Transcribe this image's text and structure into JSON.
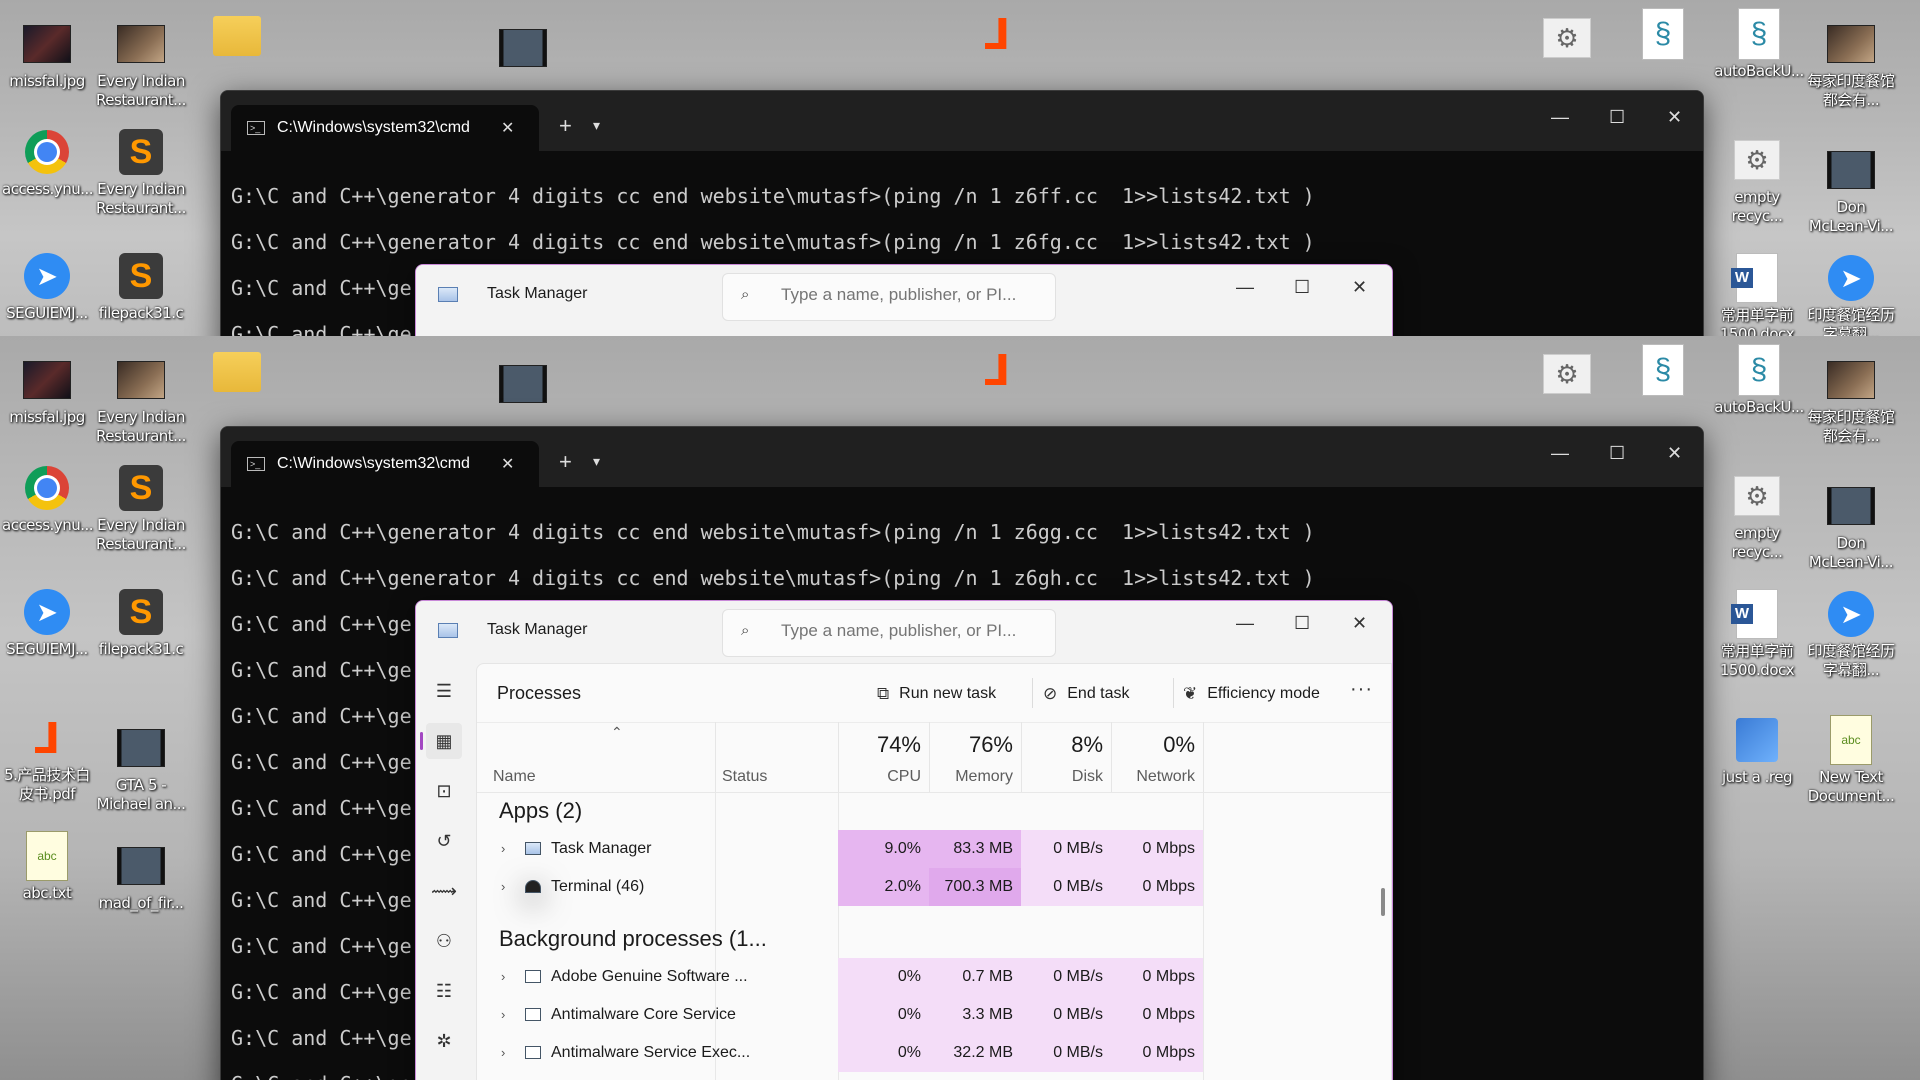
{
  "desktop": {
    "icons_left": [
      {
        "label": "missfal.jpg",
        "icon": "photo-thumb-icon"
      },
      {
        "label": "Every Indian Restaurant...",
        "icon": "video-thumb-icon"
      },
      {
        "label": "access.ynu...",
        "icon": "chrome-icon"
      },
      {
        "label": "Every Indian Restaurant...",
        "icon": "sublime-icon"
      },
      {
        "label": "SEGUIEMJ...",
        "icon": "blue-app-icon"
      },
      {
        "label": "filepack31.c",
        "icon": "sublime-icon"
      },
      {
        "label": "5.产品技术白皮书.pdf",
        "icon": "foxit-icon"
      },
      {
        "label": "GTA 5 - Michael an...",
        "icon": "video-thumb-icon"
      },
      {
        "label": "abc.txt",
        "icon": "notepad-icon"
      },
      {
        "label": "mad_of_fir...",
        "icon": "video-thumb-icon"
      }
    ],
    "icons_right": [
      {
        "label": "autoBackU...",
        "icon": "script-icon"
      },
      {
        "label": "每家印度餐馆都会有...",
        "icon": "photo-thumb-icon"
      },
      {
        "label": "empty recyc...",
        "icon": "gear-icon"
      },
      {
        "label": "Don McLean-Vi...",
        "icon": "video-thumb-icon"
      },
      {
        "label": "常用单字前1500.docx",
        "icon": "word-icon"
      },
      {
        "label": "印度餐馆经历字幕翻...",
        "icon": "blue-app-icon"
      },
      {
        "label": "just a .reg",
        "icon": "reg-icon"
      },
      {
        "label": "New Text Document...",
        "icon": "notepad-icon"
      }
    ]
  },
  "terminal": {
    "tab_title": "C:\\Windows\\system32\\cmd",
    "new_tab": "+",
    "dropdown": "⌄",
    "minimize": "—",
    "maximize": "☐",
    "close": "✕",
    "top_lines": [
      "G:\\C and C++\\generator 4 digits cc end website\\mutasf>(ping /n 1 z6ff.cc  1>>lists42.txt )",
      "G:\\C and C++\\generator 4 digits cc end website\\mutasf>(ping /n 1 z6fg.cc  1>>lists42.txt )",
      "G:\\C and C++\\ger",
      "G:\\C and C++\\ger"
    ],
    "bottom_lines": [
      "G:\\C and C++\\generator 4 digits cc end website\\mutasf>(ping /n 1 z6gg.cc  1>>lists42.txt )",
      "G:\\C and C++\\generator 4 digits cc end website\\mutasf>(ping /n 1 z6gh.cc  1>>lists42.txt )",
      "G:\\C and C++\\ger",
      "G:\\C and C++\\ger",
      "G:\\C and C++\\ger",
      "G:\\C and C++\\ger",
      "G:\\C and C++\\ger",
      "G:\\C and C++\\ger",
      "G:\\C and C++\\ger",
      "G:\\C and C++\\ger",
      "G:\\C and C++\\ger",
      "G:\\C and C++\\ger",
      "G:\\C and C++\\ger"
    ]
  },
  "taskmanager": {
    "title": "Task Manager",
    "search_placeholder": "Type a name, publisher, or PI...",
    "page_title": "Processes",
    "run_new_task": "Run new task",
    "end_task": "End task",
    "efficiency_mode": "Efficiency mode",
    "more": "···",
    "columns": {
      "name": "Name",
      "status": "Status",
      "cpu_pct": "74%",
      "cpu": "CPU",
      "mem_pct": "76%",
      "mem": "Memory",
      "disk_pct": "8%",
      "disk": "Disk",
      "net_pct": "0%",
      "net": "Network"
    },
    "group_apps": "Apps (2)",
    "apps": [
      {
        "name": "Task Manager",
        "cpu": "9.0%",
        "mem": "83.3 MB",
        "disk": "0 MB/s",
        "net": "0 Mbps"
      },
      {
        "name": "Terminal (46)",
        "cpu": "2.0%",
        "mem": "700.3 MB",
        "disk": "0 MB/s",
        "net": "0 Mbps"
      }
    ],
    "group_bg": "Background processes (1...",
    "background": [
      {
        "name": "Adobe Genuine Software ...",
        "cpu": "0%",
        "mem": "0.7 MB",
        "disk": "0 MB/s",
        "net": "0 Mbps"
      },
      {
        "name": "Antimalware Core Service",
        "cpu": "0%",
        "mem": "3.3 MB",
        "disk": "0 MB/s",
        "net": "0 Mbps"
      },
      {
        "name": "Antimalware Service Exec...",
        "cpu": "0%",
        "mem": "32.2 MB",
        "disk": "0 MB/s",
        "net": "0 Mbps"
      }
    ]
  },
  "colors": {
    "cpu_high": "#e6b6f0",
    "cpu_low": "#f4ddf8",
    "accent": "#a347c2"
  }
}
